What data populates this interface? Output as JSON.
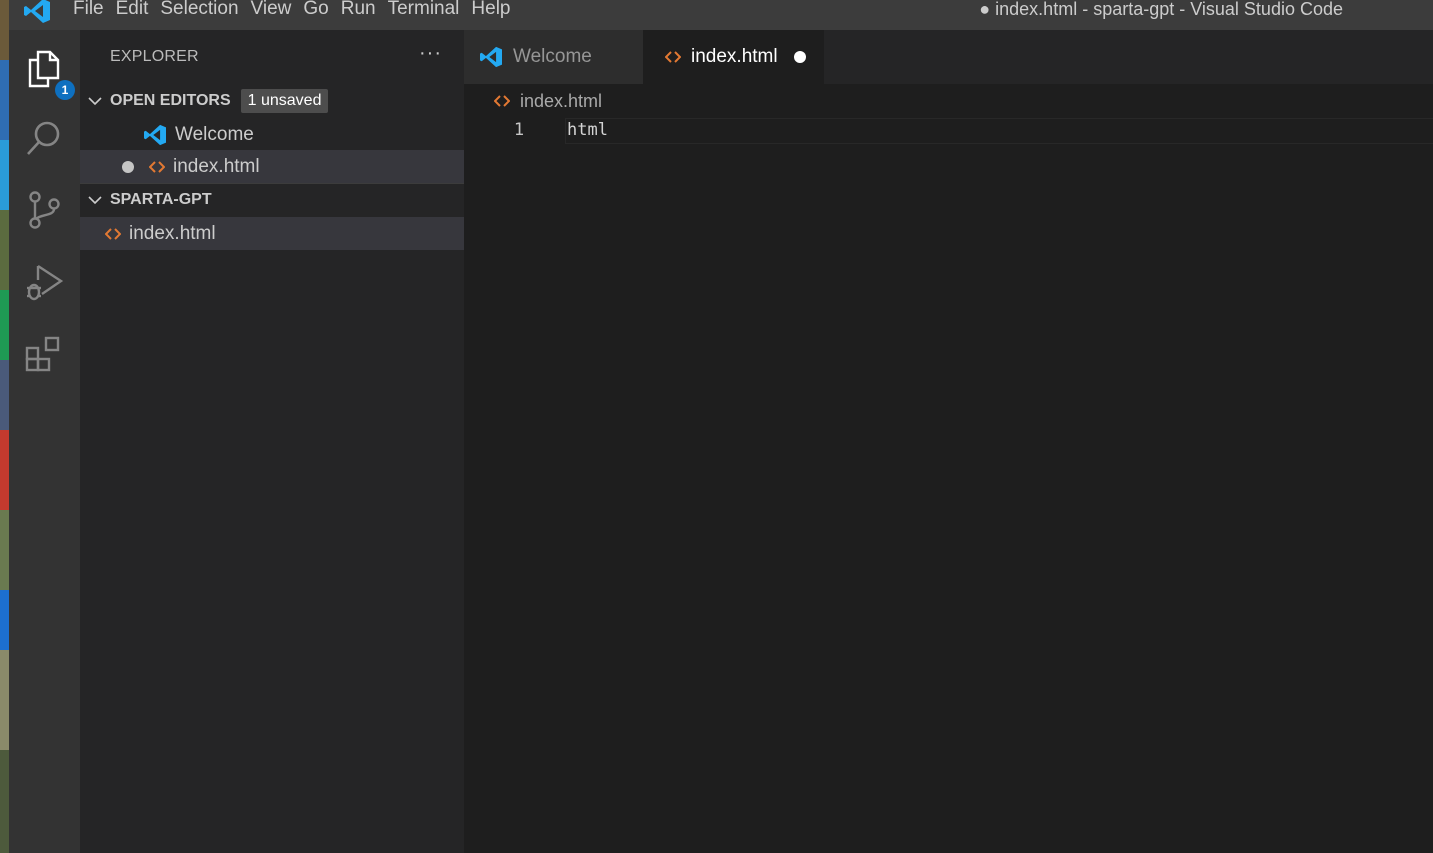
{
  "window": {
    "title": "● index.html - sparta-gpt - Visual Studio Code"
  },
  "menu": [
    "File",
    "Edit",
    "Selection",
    "View",
    "Go",
    "Run",
    "Terminal",
    "Help"
  ],
  "activity_bar": {
    "explorer_badge": "1",
    "items": [
      "explorer-icon",
      "search-icon",
      "source-control-icon",
      "run-debug-icon",
      "extensions-icon"
    ]
  },
  "sidebar": {
    "title": "EXPLORER",
    "more": "···",
    "open_editors": {
      "label": "OPEN EDITORS",
      "badge": "1 unsaved",
      "items": [
        {
          "label": "Welcome",
          "icon": "vscode-logo-icon"
        },
        {
          "label": "index.html",
          "icon": "html-file-icon",
          "dirty": true
        }
      ]
    },
    "workspace": {
      "label": "SPARTA-GPT",
      "files": [
        {
          "label": "index.html",
          "icon": "html-file-icon"
        }
      ]
    }
  },
  "tabs": [
    {
      "label": "Welcome",
      "active": false
    },
    {
      "label": "index.html",
      "active": true,
      "dirty": true
    }
  ],
  "breadcrumb": {
    "file": "index.html"
  },
  "editor": {
    "lines": [
      {
        "number": "1",
        "text": "html"
      }
    ]
  },
  "colors": {
    "accent": "#0e70c0",
    "html_icon": "#e37933",
    "vscode_blue": "#23a9f2"
  }
}
